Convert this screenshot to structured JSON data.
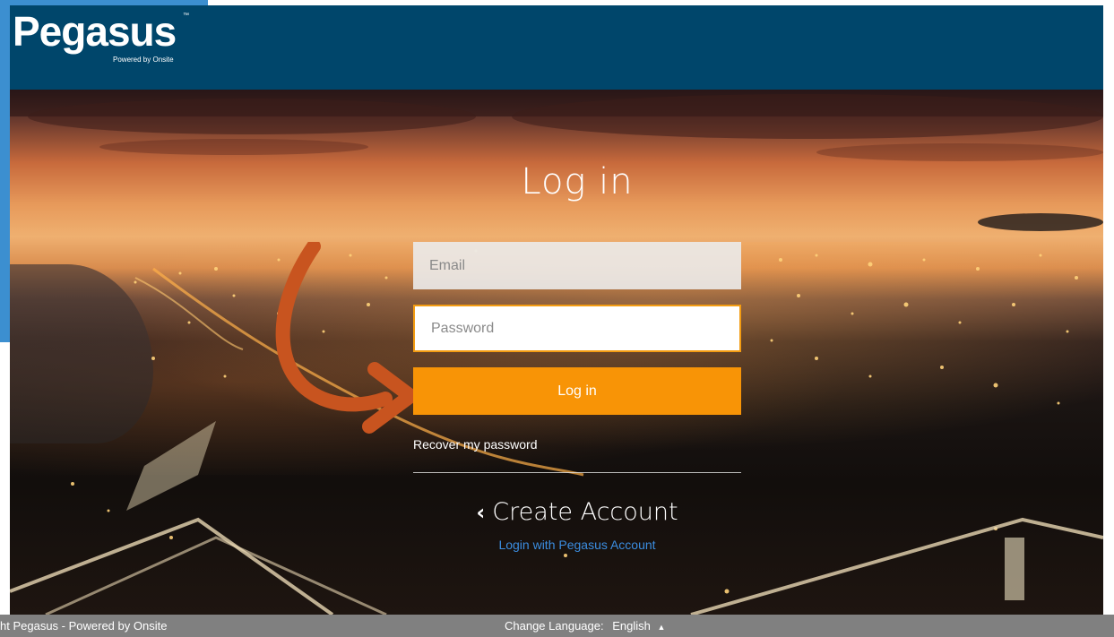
{
  "header": {
    "logo_text": "Pegasus",
    "logo_tm": "™",
    "logo_subtitle": "Powered by Onsite",
    "background_color": "#00466b"
  },
  "login": {
    "title": "Log in",
    "email_placeholder": "Email",
    "password_placeholder": "Password",
    "submit_label": "Log in",
    "recover_link": "Recover my password",
    "create_account_label": "Create Account",
    "create_account_icon": "chevron-left-icon",
    "pegasus_login_link": "Login with Pegasus Account",
    "accent_color": "#f89406"
  },
  "footer": {
    "copyright": "ht Pegasus - Powered by Onsite",
    "language_label": "Change Language:",
    "language_value": "English",
    "language_caret_icon": "caret-up-icon"
  },
  "annotation": {
    "arrow_icon": "curved-arrow-icon",
    "arrow_color": "#c8541f"
  }
}
